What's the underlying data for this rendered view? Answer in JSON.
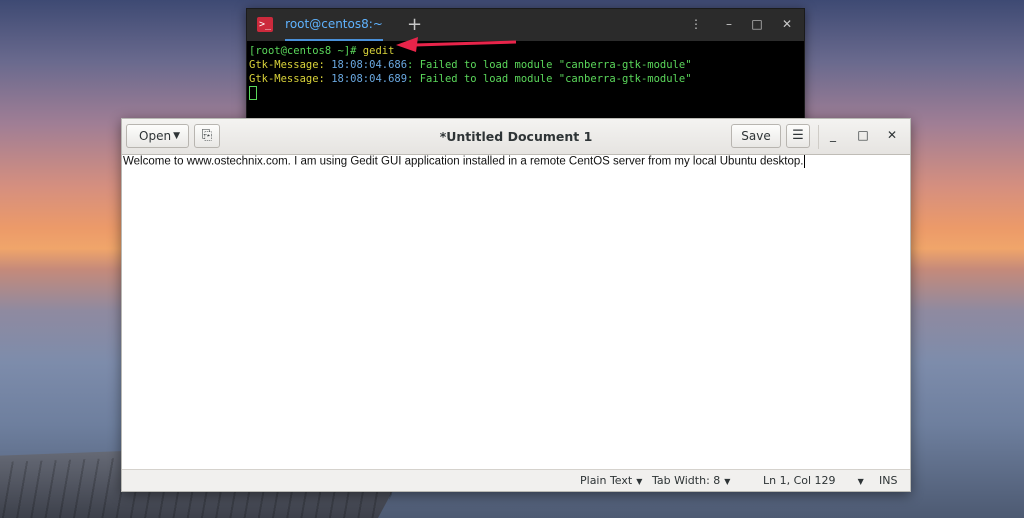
{
  "terminal": {
    "tab_title": "root@centos8:~",
    "new_tab_glyph": "+",
    "app_icon_glyph": ">_",
    "controls": {
      "menu": "⋮",
      "minimize": "–",
      "maximize": "□",
      "close": "✕"
    },
    "prompt": "[root@centos8 ~]# ",
    "command": "gedit",
    "messages": [
      {
        "source": "Gtk-Message:",
        "time": "18:08:04.686",
        "text": ": Failed to load module \"canberra-gtk-module\""
      },
      {
        "source": "Gtk-Message:",
        "time": "18:08:04.689",
        "text": ": Failed to load module \"canberra-gtk-module\""
      }
    ]
  },
  "gedit": {
    "title": "*Untitled Document 1",
    "open_label": "Open",
    "new_tab_icon": "⎘",
    "save_label": "Save",
    "menu_glyph": "☰",
    "controls": {
      "minimize": "_",
      "maximize": "□",
      "close": "✕"
    },
    "content": "Welcome to www.ostechnix.com. I am using Gedit GUI application installed in a remote CentOS server from my local Ubuntu desktop.",
    "status": {
      "language": "Plain Text",
      "tab_width": "Tab Width: 8",
      "position": "Ln 1, Col 129",
      "mode": "INS"
    }
  },
  "colors": {
    "arrow": "#e8244a",
    "terminal_green": "#5bd75b",
    "terminal_yellow": "#d8d23a",
    "terminal_blue": "#6aa8e0"
  }
}
